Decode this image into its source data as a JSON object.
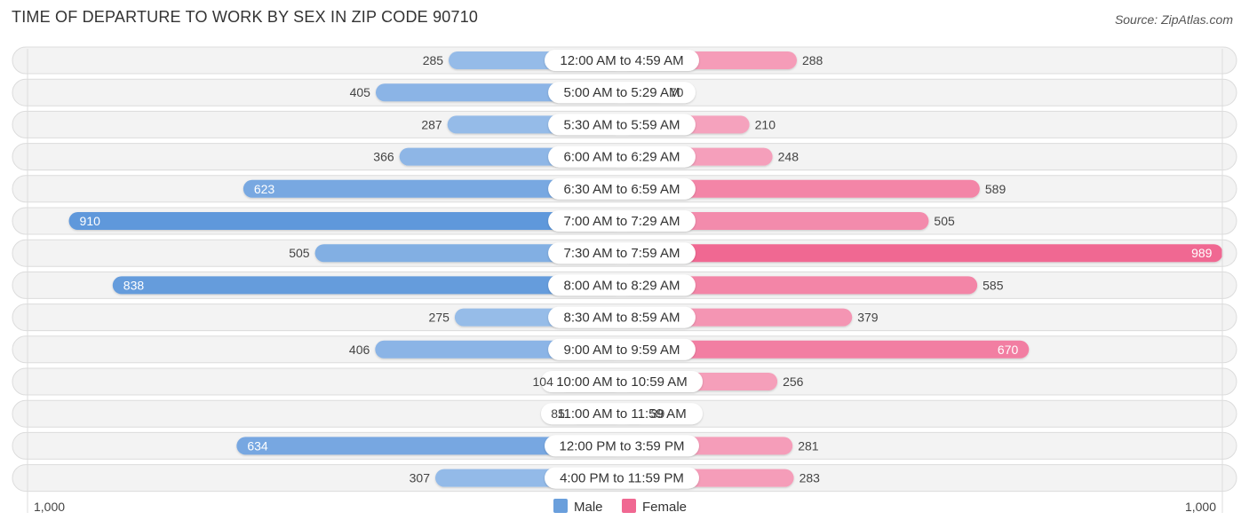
{
  "chart_data": {
    "type": "bar",
    "orientation": "horizontal-diverging",
    "title": "TIME OF DEPARTURE TO WORK BY SEX IN ZIP CODE 90710",
    "source": "Source: ZipAtlas.com",
    "categories": [
      "12:00 AM to 4:59 AM",
      "5:00 AM to 5:29 AM",
      "5:30 AM to 5:59 AM",
      "6:00 AM to 6:29 AM",
      "6:30 AM to 6:59 AM",
      "7:00 AM to 7:29 AM",
      "7:30 AM to 7:59 AM",
      "8:00 AM to 8:29 AM",
      "8:30 AM to 8:59 AM",
      "9:00 AM to 9:59 AM",
      "10:00 AM to 10:59 AM",
      "11:00 AM to 11:59 AM",
      "12:00 PM to 3:59 PM",
      "4:00 PM to 11:59 PM"
    ],
    "series": [
      {
        "name": "Male",
        "color": "#6a9fdc",
        "values": [
          285,
          405,
          287,
          366,
          623,
          910,
          505,
          838,
          275,
          406,
          104,
          85,
          634,
          307
        ]
      },
      {
        "name": "Female",
        "color": "#f06892",
        "values": [
          288,
          70,
          210,
          248,
          589,
          505,
          989,
          585,
          379,
          670,
          256,
          39,
          281,
          283
        ]
      }
    ],
    "axis": {
      "left_label": "1,000",
      "right_label": "1,000",
      "max": 1000
    },
    "legend": {
      "position": "bottom-center",
      "items": [
        "Male",
        "Female"
      ]
    }
  }
}
